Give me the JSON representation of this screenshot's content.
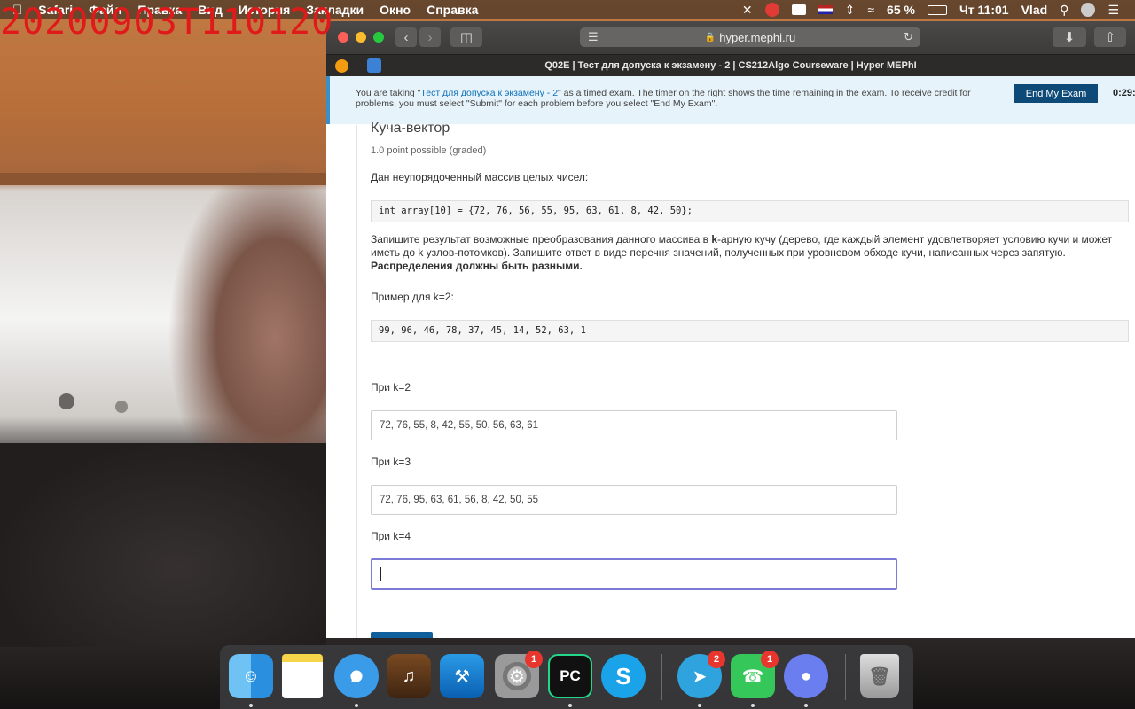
{
  "overlay": {
    "timestamp": "20200903T110120"
  },
  "menubar": {
    "items": [
      "Safari",
      "Файл",
      "Правка",
      "Вид",
      "История",
      "Закладки",
      "Окно",
      "Справка"
    ],
    "battery": "65 %",
    "clock": "Чт 11:01",
    "user": "Vlad"
  },
  "browser": {
    "url": "hyper.mephi.ru",
    "tab_title": "Q02E | Тест для допуска к экзамену - 2 | CS212Algo Courseware | Hyper MEPhI"
  },
  "banner": {
    "prefix": "You are taking \"",
    "exam_link": "Тест для допуска к экзамену - 2",
    "suffix": "\" as a timed exam. The timer on the right shows the time remaining in the exam. To receive credit for problems, you must select \"Submit\" for each problem before you select \"End My Exam\".",
    "end_button": "End My Exam",
    "timer": "0:29:"
  },
  "problem": {
    "title": "Куча-вектор",
    "points": "1.0 point possible (graded)",
    "intro": "Дан неупорядоченный массив целых чисел:",
    "array_code": "int array[10] = {72, 76, 56, 55, 95, 63, 61, 8, 42, 50};",
    "task_part1": "Запишите результат возможные преобразования данного массива в ",
    "task_k": "k",
    "task_part2": "-арную кучу (дерево, где каждый элемент удовлетворяет условию кучи и может иметь до k узлов-потомков). Запишите ответ в виде перечня значений, полученных при уровневом обходе кучи, написанных через запятую. ",
    "task_bold": "Распределения должны быть разными.",
    "example_label": "Пример для k=2:",
    "example_code": "99, 96, 46, 78, 37, 45, 14, 52, 63, 1",
    "answers": [
      {
        "label": "При k=2",
        "value": "72, 76, 55, 8, 42, 55, 50, 56, 63, 61"
      },
      {
        "label": "При k=3",
        "value": "72, 76, 95, 63, 61, 56, 8, 42, 50, 55"
      },
      {
        "label": "При k=4",
        "value": ""
      }
    ]
  },
  "dock": {
    "apps": [
      "finder",
      "notes",
      "safari",
      "garageband",
      "xcode",
      "system-preferences",
      "pycharm",
      "skype",
      "telegram",
      "facetime",
      "discord",
      "trash"
    ],
    "badges": {
      "system_preferences": "1",
      "telegram": "2",
      "facetime": "1"
    },
    "pycharm_label": "PC"
  }
}
